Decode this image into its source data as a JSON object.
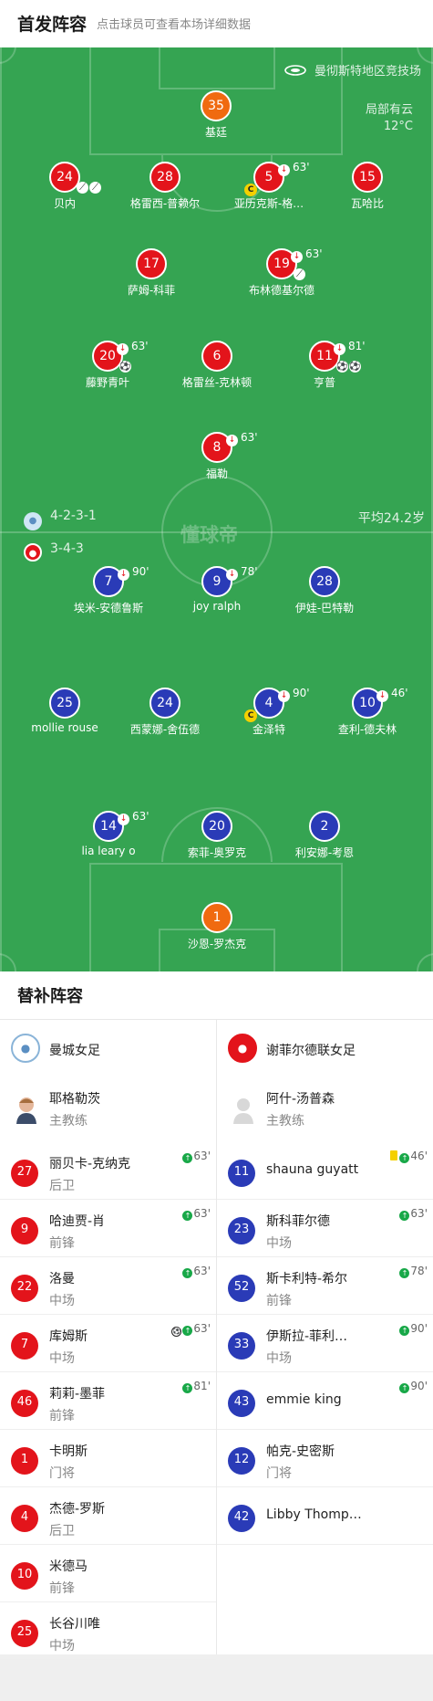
{
  "header": {
    "title": "首发阵容",
    "subtitle": "点击球员可查看本场详细数据"
  },
  "pitch_info": {
    "stadium": "曼彻斯特地区竞技场",
    "weather": "局部有云",
    "temperature": "12°C",
    "watermark": "懂球帝"
  },
  "home_formation": "4-2-3-1",
  "away_formation": "3-4-3",
  "away_avg_age": "平均24.2岁",
  "home_players": [
    {
      "num": "35",
      "name": "基廷",
      "color": "orange"
    },
    {
      "num": "24",
      "name": "贝内",
      "color": "red",
      "events": [
        "assist",
        "assist"
      ]
    },
    {
      "num": "28",
      "name": "格雷西-普赖尔",
      "color": "red"
    },
    {
      "num": "5",
      "name": "亚历克斯-格…",
      "color": "red",
      "sub": "63'",
      "captain": "C"
    },
    {
      "num": "15",
      "name": "瓦哈比",
      "color": "red"
    },
    {
      "num": "17",
      "name": "萨姆-科菲",
      "color": "red"
    },
    {
      "num": "19",
      "name": "布林德基尔德",
      "color": "red",
      "sub": "63'",
      "events": [
        "assist"
      ]
    },
    {
      "num": "20",
      "name": "藤野青叶",
      "color": "red",
      "sub": "63'",
      "events": [
        "goal"
      ]
    },
    {
      "num": "6",
      "name": "格雷丝-克林顿",
      "color": "red"
    },
    {
      "num": "11",
      "name": "亨普",
      "color": "red",
      "sub": "81'",
      "events": [
        "goal",
        "goal"
      ]
    },
    {
      "num": "8",
      "name": "福勒",
      "color": "red",
      "sub": "63'"
    }
  ],
  "away_players": [
    {
      "num": "7",
      "name": "埃米-安德鲁斯",
      "color": "blue",
      "sub": "90'"
    },
    {
      "num": "9",
      "name": "joy ralph",
      "color": "blue",
      "sub": "78'"
    },
    {
      "num": "28",
      "name": "伊娃-巴特勒",
      "color": "blue"
    },
    {
      "num": "25",
      "name": "mollie rouse",
      "color": "blue"
    },
    {
      "num": "24",
      "name": "西蒙娜-舍伍德",
      "color": "blue"
    },
    {
      "num": "4",
      "name": "金泽特",
      "color": "blue",
      "sub": "90'",
      "captain": "C"
    },
    {
      "num": "10",
      "name": "查利-德夫林",
      "color": "blue",
      "sub": "46'"
    },
    {
      "num": "14",
      "name": "lia leary o",
      "color": "blue",
      "sub": "63'"
    },
    {
      "num": "20",
      "name": "索菲-奥罗克",
      "color": "blue"
    },
    {
      "num": "2",
      "name": "利安娜-考恩",
      "color": "blue"
    },
    {
      "num": "1",
      "name": "沙恩-罗杰克",
      "color": "orange"
    }
  ],
  "subs": {
    "title": "替补阵容",
    "home": {
      "team": "曼城女足",
      "coach": {
        "name": "耶格勒茨",
        "role": "主教练"
      },
      "players": [
        {
          "num": "27",
          "name": "丽贝卡-克纳克",
          "pos": "后卫",
          "sub": "63'"
        },
        {
          "num": "9",
          "name": "哈迪贾-肖",
          "pos": "前锋",
          "sub": "63'"
        },
        {
          "num": "22",
          "name": "洛曼",
          "pos": "中场",
          "sub": "63'"
        },
        {
          "num": "7",
          "name": "库姆斯",
          "pos": "中场",
          "sub": "63'",
          "goal": true
        },
        {
          "num": "46",
          "name": "莉莉-墨菲",
          "pos": "前锋",
          "sub": "81'"
        },
        {
          "num": "1",
          "name": "卡明斯",
          "pos": "门将"
        },
        {
          "num": "4",
          "name": "杰德-罗斯",
          "pos": "后卫"
        },
        {
          "num": "10",
          "name": "米德马",
          "pos": "前锋"
        },
        {
          "num": "25",
          "name": "长谷川唯",
          "pos": "中场"
        }
      ]
    },
    "away": {
      "team": "谢菲尔德联女足",
      "coach": {
        "name": "阿什-汤普森",
        "role": "主教练"
      },
      "players": [
        {
          "num": "11",
          "name": "shauna guyatt",
          "pos": "",
          "sub": "46'",
          "yellow": true
        },
        {
          "num": "23",
          "name": "斯科菲尔德",
          "pos": "中场",
          "sub": "63'"
        },
        {
          "num": "52",
          "name": "斯卡利特-希尔",
          "pos": "前锋",
          "sub": "78'"
        },
        {
          "num": "33",
          "name": "伊斯拉-菲利…",
          "pos": "中场",
          "sub": "90'"
        },
        {
          "num": "43",
          "name": "emmie king",
          "pos": "",
          "sub": "90'"
        },
        {
          "num": "12",
          "name": "帕克-史密斯",
          "pos": "门将"
        },
        {
          "num": "42",
          "name": "Libby Thomp…",
          "pos": ""
        }
      ]
    }
  }
}
